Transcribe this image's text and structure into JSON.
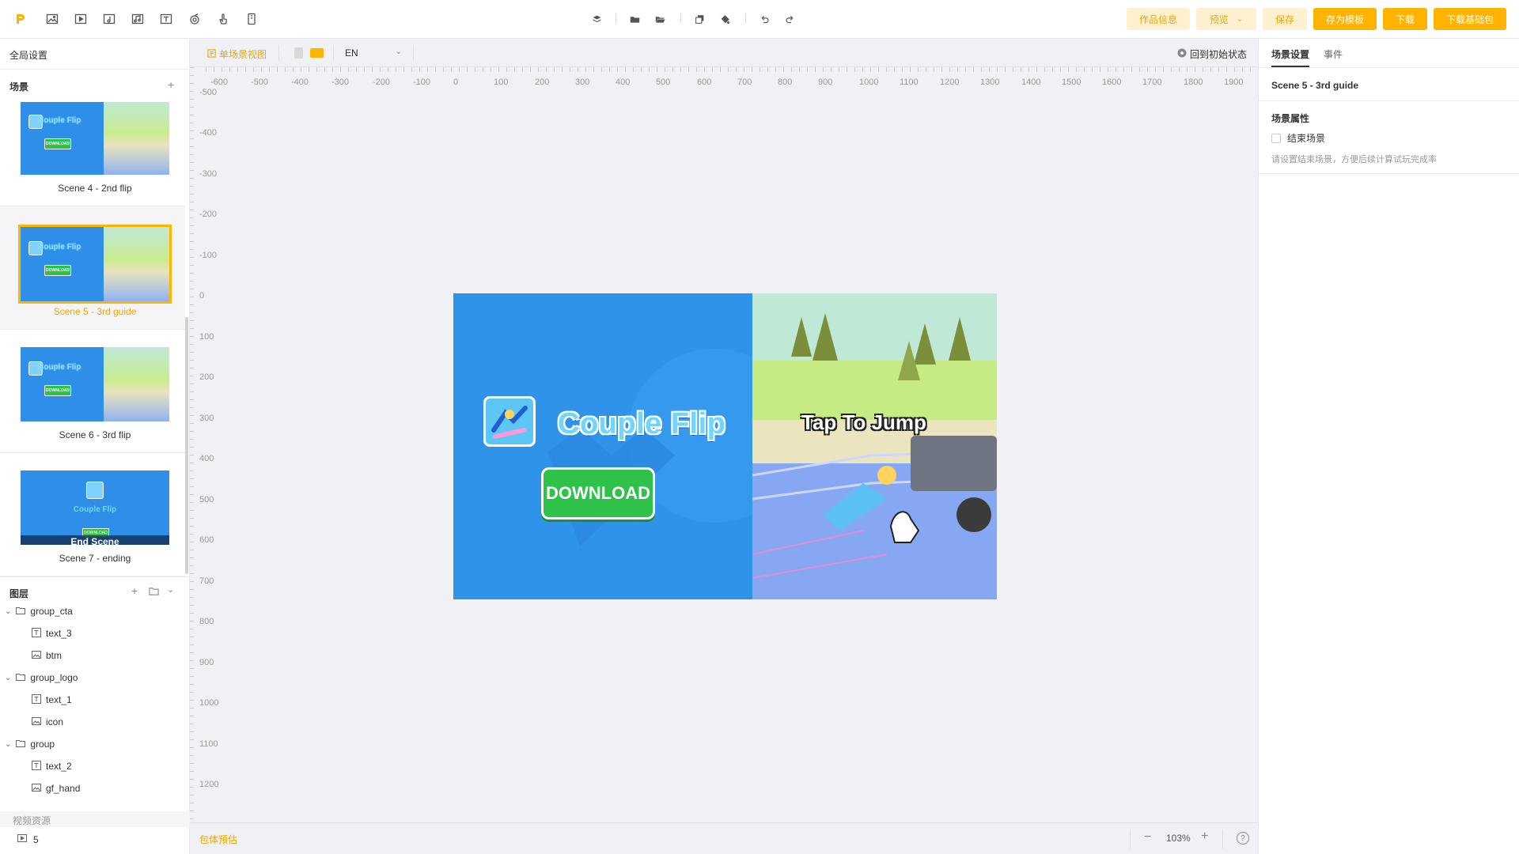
{
  "topbar": {
    "tools": [
      "pointer-icon",
      "image-icon",
      "video-icon",
      "audio-icon",
      "music-icon",
      "text-icon",
      "spinner-icon",
      "hand-icon",
      "phone-icon"
    ],
    "center_tools": [
      "layers-icon",
      "folder-icon",
      "folder-open-icon",
      "copy-icon",
      "paint-icon",
      "undo-icon",
      "redo-icon"
    ],
    "buttons": {
      "info": "作品信息",
      "preview": "预览",
      "save": "保存",
      "save_template": "存为模板",
      "download": "下载",
      "download_base": "下载基础包"
    }
  },
  "left": {
    "global_settings": "全局设置",
    "scenes_title": "场景",
    "scenes": [
      {
        "label": "Scene 4 - 2nd flip"
      },
      {
        "label": "Scene 5 - 3rd guide",
        "active": true
      },
      {
        "label": "Scene 6 - 3rd flip"
      },
      {
        "label": "Scene 7 - ending",
        "overlay": "End Scene"
      }
    ],
    "thumb_title": "Couple Flip",
    "thumb_download": "DOWNLOAD",
    "layers_title": "图层",
    "layers": [
      {
        "label": "group_cta",
        "type": "group"
      },
      {
        "label": "text_3",
        "type": "text"
      },
      {
        "label": "btm",
        "type": "image"
      },
      {
        "label": "group_logo",
        "type": "group"
      },
      {
        "label": "text_1",
        "type": "text"
      },
      {
        "label": "icon",
        "type": "image"
      },
      {
        "label": "group",
        "type": "group"
      },
      {
        "label": "text_2",
        "type": "text"
      },
      {
        "label": "gf_hand",
        "type": "image"
      }
    ],
    "video_assets_title": "视频资源",
    "video_assets_item": "5"
  },
  "center": {
    "single_scene_view": "单场景视图",
    "language": "EN",
    "reset_state": "回到初始状态",
    "h_ticks": [
      "-600",
      "-500",
      "-400",
      "-300",
      "-200",
      "-100",
      "0",
      "100",
      "200",
      "300",
      "400",
      "500",
      "600",
      "700",
      "800",
      "900",
      "1000",
      "1100",
      "1200",
      "1300",
      "1400",
      "1500",
      "1600",
      "1700",
      "1800",
      "1900"
    ],
    "v_ticks": [
      "-500",
      "-400",
      "-300",
      "-200",
      "-100",
      "0",
      "100",
      "200",
      "300",
      "400",
      "500",
      "600",
      "700",
      "800",
      "900",
      "1000",
      "1100",
      "1200"
    ],
    "preview": {
      "title": "Couple Flip",
      "download": "DOWNLOAD",
      "tap_text": "Tap To Jump"
    },
    "package_estimate": "包体预估",
    "zoom": "103%"
  },
  "right": {
    "tab_scene": "场景设置",
    "tab_events": "事件",
    "scene_name": "Scene 5 - 3rd guide",
    "props_title": "场景属性",
    "end_scene_label": "结束场景",
    "end_scene_hint": "请设置结束场景，方便后续计算试玩完成率"
  },
  "colors": {
    "accent": "#ffb400",
    "accent_light": "#fff1cf",
    "preview_blue": "#2f93ea",
    "download_green": "#2fc24a"
  }
}
